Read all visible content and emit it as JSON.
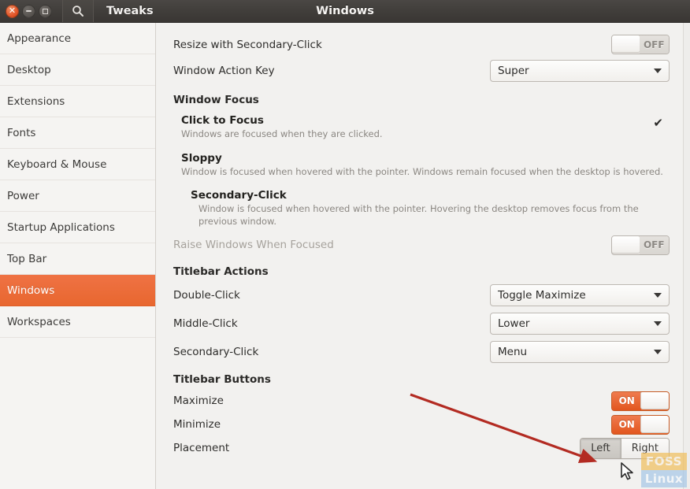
{
  "window": {
    "app_name": "Tweaks",
    "title": "Windows",
    "controls": {
      "close": "close-button",
      "minimize": "minimize-button",
      "maximize": "maximize-button"
    },
    "search_icon": "search-icon"
  },
  "sidebar": {
    "items": [
      {
        "label": "Appearance",
        "active": false
      },
      {
        "label": "Desktop",
        "active": false
      },
      {
        "label": "Extensions",
        "active": false
      },
      {
        "label": "Fonts",
        "active": false
      },
      {
        "label": "Keyboard & Mouse",
        "active": false
      },
      {
        "label": "Power",
        "active": false
      },
      {
        "label": "Startup Applications",
        "active": false
      },
      {
        "label": "Top Bar",
        "active": false
      },
      {
        "label": "Windows",
        "active": true
      },
      {
        "label": "Workspaces",
        "active": false
      }
    ]
  },
  "content": {
    "resize_secondary_click": {
      "label": "Resize with Secondary-Click",
      "state": "OFF"
    },
    "window_action_key": {
      "label": "Window Action Key",
      "value": "Super"
    },
    "window_focus": {
      "heading": "Window Focus",
      "options": [
        {
          "title": "Click to Focus",
          "desc": "Windows are focused when they are clicked.",
          "selected": true,
          "check": "✔"
        },
        {
          "title": "Sloppy",
          "desc": "Window is focused when hovered with the pointer. Windows remain focused when the desktop is hovered.",
          "selected": false,
          "check": ""
        },
        {
          "title": "Secondary-Click",
          "desc": "Window is focused when hovered with the pointer. Hovering the desktop removes focus from the previous window.",
          "selected": false,
          "check": ""
        }
      ]
    },
    "raise_windows": {
      "label": "Raise Windows When Focused",
      "state": "OFF"
    },
    "titlebar_actions": {
      "heading": "Titlebar Actions",
      "rows": [
        {
          "label": "Double-Click",
          "value": "Toggle Maximize"
        },
        {
          "label": "Middle-Click",
          "value": "Lower"
        },
        {
          "label": "Secondary-Click",
          "value": "Menu"
        }
      ]
    },
    "titlebar_buttons": {
      "heading": "Titlebar Buttons",
      "maximize": {
        "label": "Maximize",
        "state": "ON"
      },
      "minimize": {
        "label": "Minimize",
        "state": "ON"
      },
      "placement": {
        "label": "Placement",
        "options": [
          {
            "label": "Left",
            "selected": true
          },
          {
            "label": "Right",
            "selected": false
          }
        ]
      }
    }
  },
  "annotation": {
    "arrow_color": "#b32b22",
    "arrow_from": "521,501",
    "arrow_to": "760,588"
  },
  "watermark": {
    "line1": "FOSS",
    "line2": "Linux"
  },
  "colors": {
    "accent_orange": "#e8672f",
    "titlebar_dark": "#413e3b",
    "content_bg": "#f2f1ef",
    "sidebar_bg": "#f5f4f2"
  }
}
